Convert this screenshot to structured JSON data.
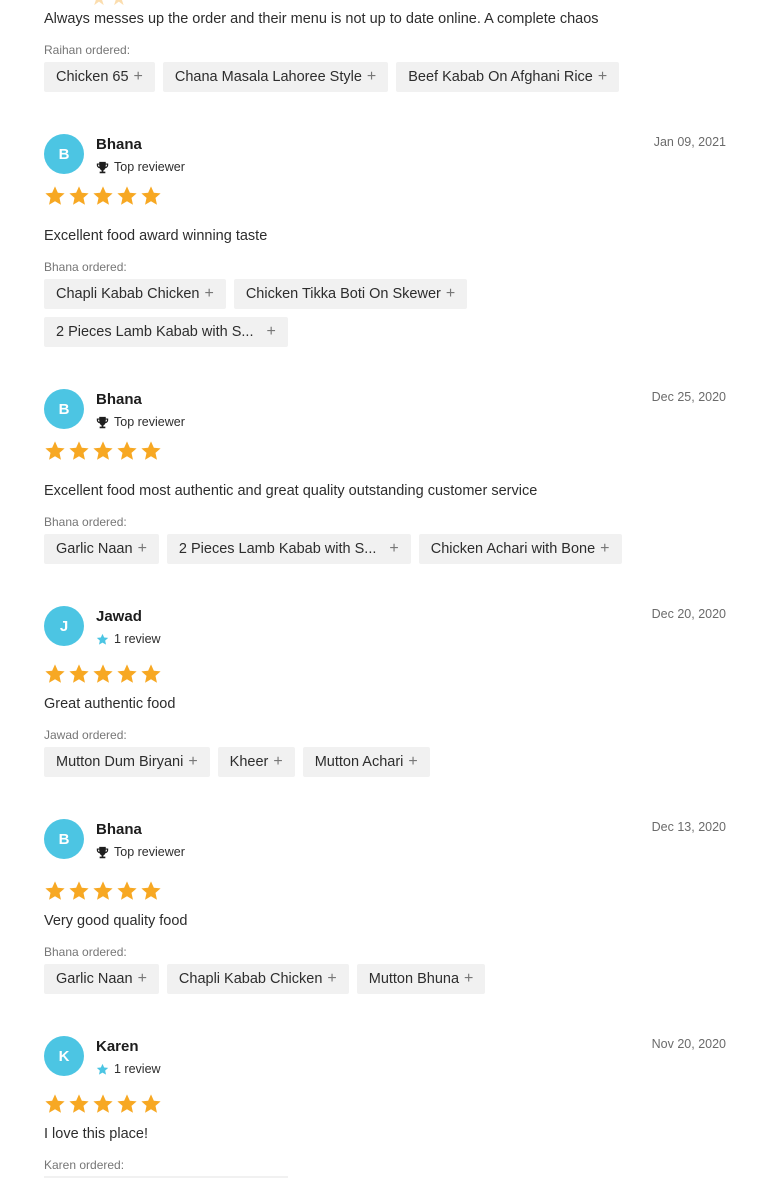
{
  "reviews": [
    {
      "text": "Always messes up the order and their menu is not up to date online. A complete chaos",
      "ordered_label": "Raihan ordered:",
      "items": [
        "Chicken 65",
        "Chana Masala Lahoree Style",
        "Beef Kabab On Afghani Rice"
      ]
    },
    {
      "initial": "B",
      "name": "Bhana",
      "badge": "Top reviewer",
      "badge_icon": "trophy-icon",
      "date": "Jan 09, 2021",
      "rating": 5,
      "text": "Excellent food award winning taste",
      "ordered_label": "Bhana ordered:",
      "items": [
        "Chapli Kabab Chicken",
        "Chicken Tikka Boti On Skewer",
        "2 Pieces Lamb Kabab with S..."
      ]
    },
    {
      "initial": "B",
      "name": "Bhana",
      "badge": "Top reviewer",
      "badge_icon": "trophy-icon",
      "date": "Dec 25, 2020",
      "rating": 5,
      "text": "Excellent food most authentic and great quality outstanding customer service",
      "ordered_label": "Bhana ordered:",
      "items": [
        "Garlic Naan",
        "2 Pieces Lamb Kabab with S...",
        "Chicken Achari with Bone"
      ]
    },
    {
      "initial": "J",
      "name": "Jawad",
      "badge": "1 review",
      "badge_icon": "star-icon",
      "date": "Dec 20, 2020",
      "rating": 5,
      "text": "Great authentic food",
      "ordered_label": "Jawad ordered:",
      "items": [
        "Mutton Dum Biryani",
        "Kheer",
        "Mutton Achari"
      ]
    },
    {
      "initial": "B",
      "name": "Bhana",
      "badge": "Top reviewer",
      "badge_icon": "trophy-icon",
      "date": "Dec 13, 2020",
      "rating": 5,
      "text": "Very good quality food",
      "ordered_label": "Bhana ordered:",
      "items": [
        "Garlic Naan",
        "Chapli Kabab Chicken",
        "Mutton Bhuna"
      ]
    },
    {
      "initial": "K",
      "name": "Karen",
      "badge": "1 review",
      "badge_icon": "star-icon",
      "date": "Nov 20, 2020",
      "rating": 5,
      "text": "I love this place!",
      "ordered_label": "Karen ordered:",
      "items": []
    }
  ],
  "colors": {
    "avatar": "#4cc5e3",
    "star": "#f7a823",
    "chip_bg": "#f1f1f1",
    "badge_star": "#4cc5e3"
  }
}
